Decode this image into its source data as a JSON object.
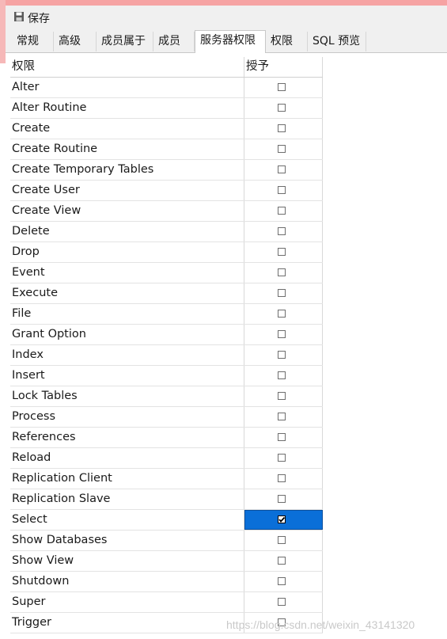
{
  "toolbar": {
    "save_label": "保存"
  },
  "tabs": [
    {
      "label": "常规"
    },
    {
      "label": "高级"
    },
    {
      "label": "成员属于"
    },
    {
      "label": "成员"
    },
    {
      "label": "服务器权限"
    },
    {
      "label": "权限"
    },
    {
      "label": "SQL 预览"
    }
  ],
  "active_tab": "服务器权限",
  "table": {
    "headers": [
      "权限",
      "授予"
    ],
    "rows": [
      {
        "privilege": "Alter",
        "granted": false
      },
      {
        "privilege": "Alter Routine",
        "granted": false
      },
      {
        "privilege": "Create",
        "granted": false
      },
      {
        "privilege": "Create Routine",
        "granted": false
      },
      {
        "privilege": "Create Temporary Tables",
        "granted": false
      },
      {
        "privilege": "Create User",
        "granted": false
      },
      {
        "privilege": "Create View",
        "granted": false
      },
      {
        "privilege": "Delete",
        "granted": false
      },
      {
        "privilege": "Drop",
        "granted": false
      },
      {
        "privilege": "Event",
        "granted": false
      },
      {
        "privilege": "Execute",
        "granted": false
      },
      {
        "privilege": "File",
        "granted": false
      },
      {
        "privilege": "Grant Option",
        "granted": false
      },
      {
        "privilege": "Index",
        "granted": false
      },
      {
        "privilege": "Insert",
        "granted": false
      },
      {
        "privilege": "Lock Tables",
        "granted": false
      },
      {
        "privilege": "Process",
        "granted": false
      },
      {
        "privilege": "References",
        "granted": false
      },
      {
        "privilege": "Reload",
        "granted": false
      },
      {
        "privilege": "Replication Client",
        "granted": false
      },
      {
        "privilege": "Replication Slave",
        "granted": false
      },
      {
        "privilege": "Select",
        "granted": true,
        "selected": true
      },
      {
        "privilege": "Show Databases",
        "granted": false
      },
      {
        "privilege": "Show View",
        "granted": false
      },
      {
        "privilege": "Shutdown",
        "granted": false
      },
      {
        "privilege": "Super",
        "granted": false
      },
      {
        "privilege": "Trigger",
        "granted": false
      }
    ]
  },
  "watermark": "https://blog.csdn.net/weixin_43141320",
  "colors": {
    "accent_pink": "#f6a3a3",
    "selection_blue": "#0a6fd8"
  }
}
